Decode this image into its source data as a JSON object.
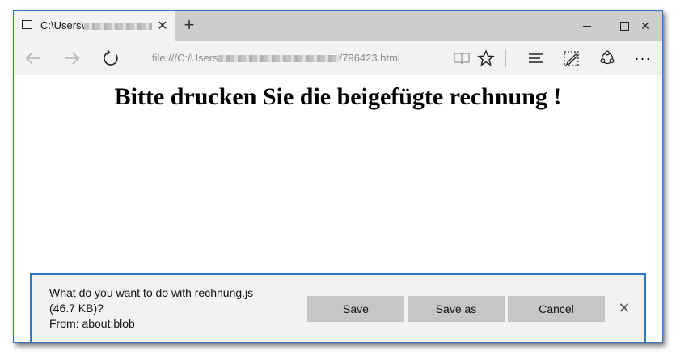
{
  "tab": {
    "title_prefix": "C:\\Users\\",
    "close_icon": "close-icon",
    "new_tab_icon": "plus-icon"
  },
  "window_controls": {
    "minimize_icon": "minimize-icon",
    "maximize_icon": "maximize-icon",
    "close_icon": "close-icon"
  },
  "address_bar": {
    "prefix": "file:///C:/Users",
    "suffix": "/796423.html"
  },
  "toolbar_icons": [
    "back-arrow-icon",
    "forward-arrow-icon",
    "refresh-icon",
    "reading-view-icon",
    "favorite-star-icon",
    "hub-icon",
    "web-note-icon",
    "share-icon",
    "more-icon"
  ],
  "page": {
    "heading": "Bitte drucken Sie die beigefügte rechnung !"
  },
  "download": {
    "line1": "What do you want to do with rechnung.js",
    "line2": "(46.7 KB)?",
    "line3": "From: about:blob",
    "save_label": "Save",
    "save_as_label": "Save as",
    "cancel_label": "Cancel"
  },
  "colors": {
    "accent": "#2b79c6",
    "tabbar": "#cdcdcd",
    "chrome": "#f2f2f2",
    "button": "#c6c6c6"
  }
}
